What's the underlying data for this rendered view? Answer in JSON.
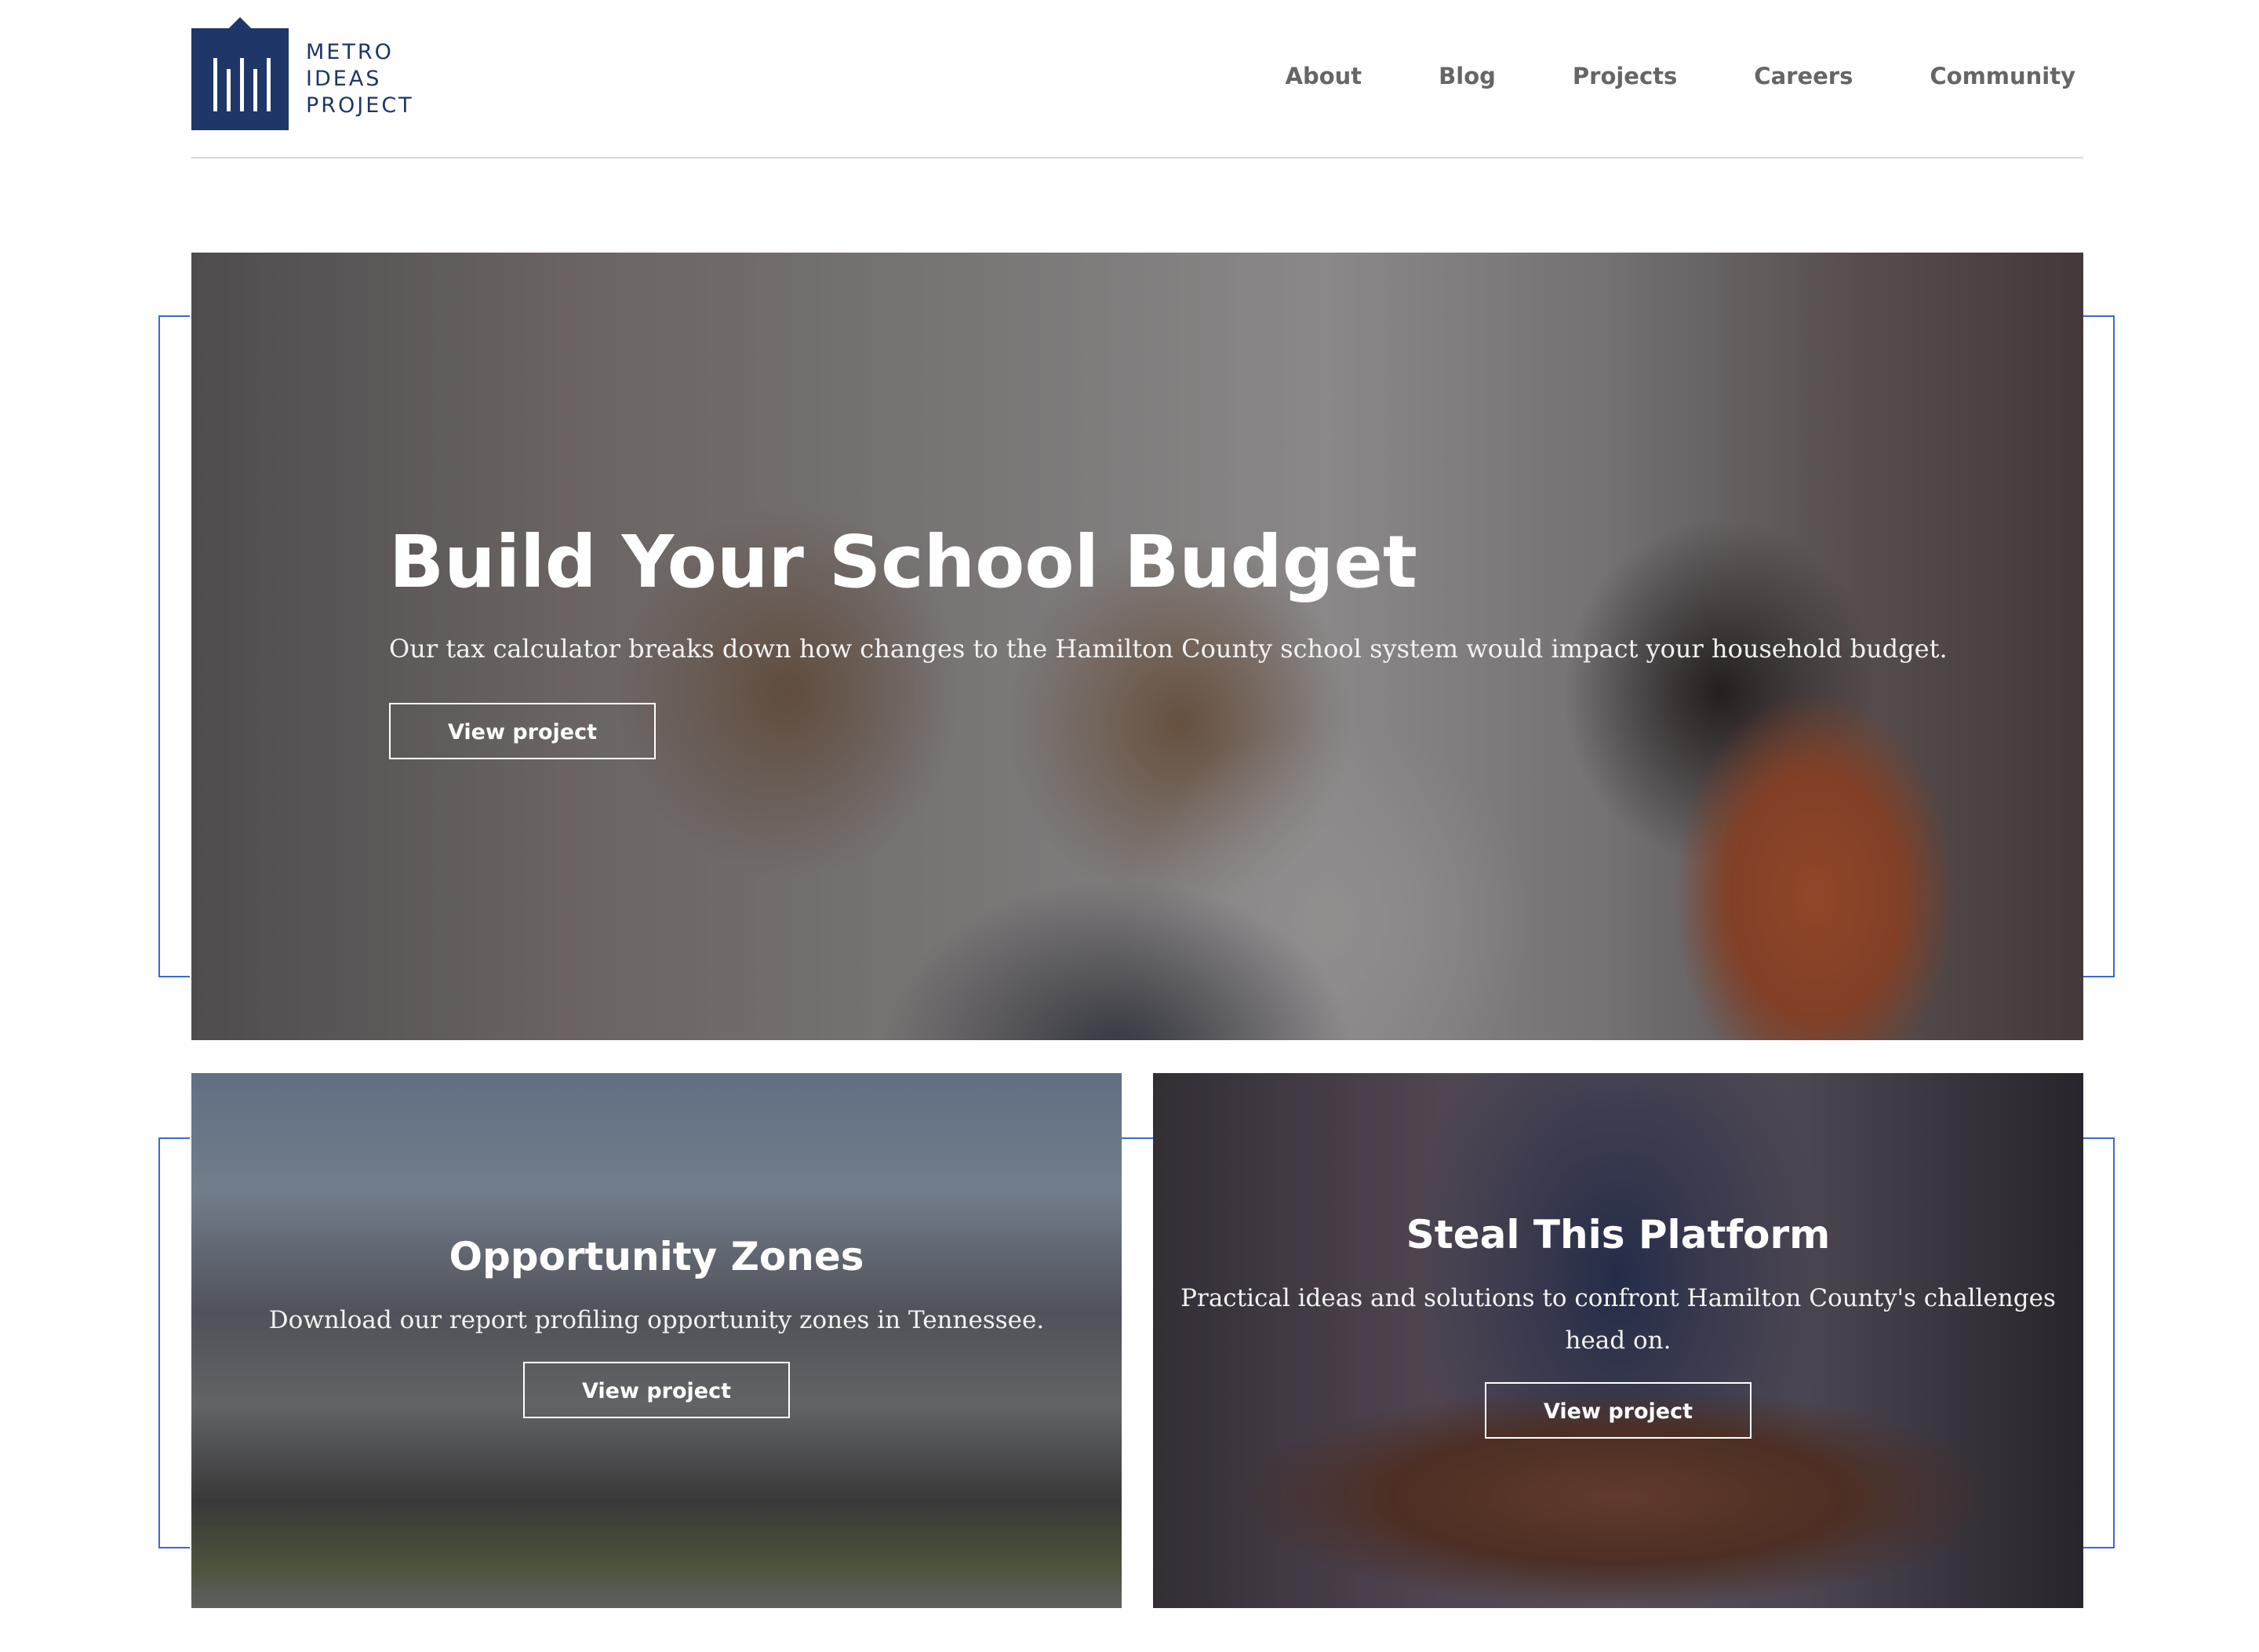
{
  "brand": {
    "name_lines": [
      "METRO",
      "IDEAS",
      "PROJECT"
    ],
    "color": "#1f3668"
  },
  "nav": {
    "items": [
      "About",
      "Blog",
      "Projects",
      "Careers",
      "Community"
    ]
  },
  "hero": {
    "title": "Build Your School Budget",
    "description": "Our tax calculator breaks down how changes to the Hamilton County school system would impact your household budget.",
    "button": "View project"
  },
  "cards": [
    {
      "title": "Opportunity Zones",
      "description": "Download our report profiling opportunity zones in Tennessee.",
      "button": "View project"
    },
    {
      "title": "Steal This Platform",
      "description": "Practical ideas and solutions to confront Hamilton County's challenges head on.",
      "button": "View project"
    }
  ],
  "colors": {
    "accent_bracket": "#3a68d8",
    "nav_text": "#666666"
  }
}
